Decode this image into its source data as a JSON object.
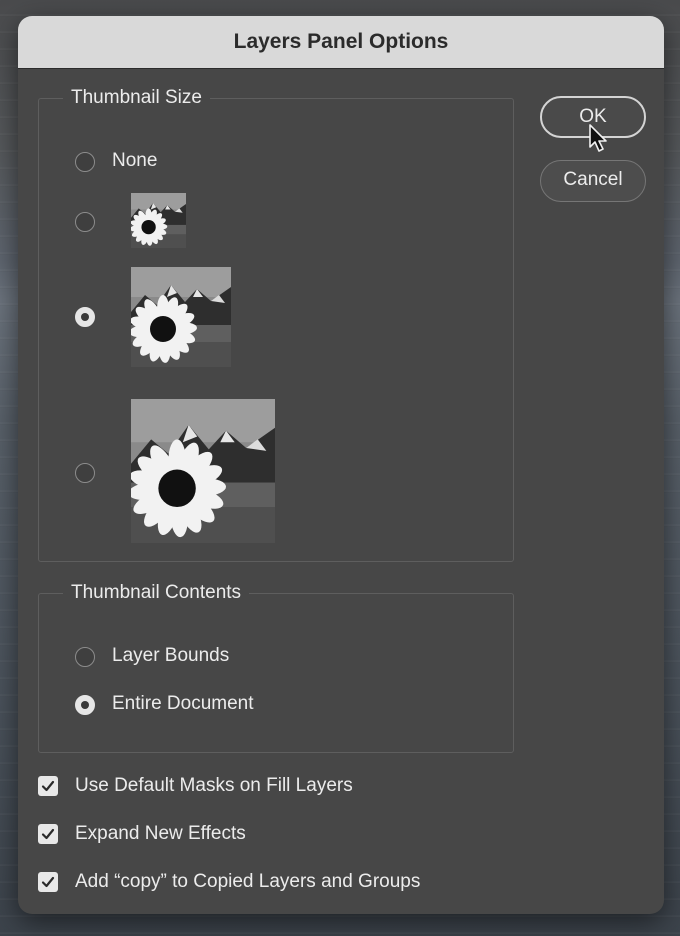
{
  "dialog": {
    "title": "Layers Panel Options"
  },
  "thumbnail_size": {
    "legend": "Thumbnail Size",
    "options": [
      {
        "label": "None",
        "selected": false
      },
      {
        "label": "",
        "size": "small",
        "selected": false
      },
      {
        "label": "",
        "size": "medium",
        "selected": true
      },
      {
        "label": "",
        "size": "large",
        "selected": false
      }
    ]
  },
  "thumbnail_contents": {
    "legend": "Thumbnail Contents",
    "options": [
      {
        "label": "Layer Bounds",
        "selected": false
      },
      {
        "label": "Entire Document",
        "selected": true
      }
    ]
  },
  "checkboxes": [
    {
      "label": "Use Default Masks on Fill Layers",
      "checked": true
    },
    {
      "label": "Expand New Effects",
      "checked": true
    },
    {
      "label": "Add “copy” to Copied Layers and Groups",
      "checked": true
    }
  ],
  "buttons": {
    "ok": "OK",
    "cancel": "Cancel"
  },
  "icons": {
    "thumbnail": "sunflower-mountain-thumbnail-icon",
    "cursor": "arrow-cursor-icon",
    "check": "checkmark-icon"
  },
  "colors": {
    "dialog_bg": "#474747",
    "titlebar_bg": "#d9d9d9",
    "text": "#ececec"
  }
}
